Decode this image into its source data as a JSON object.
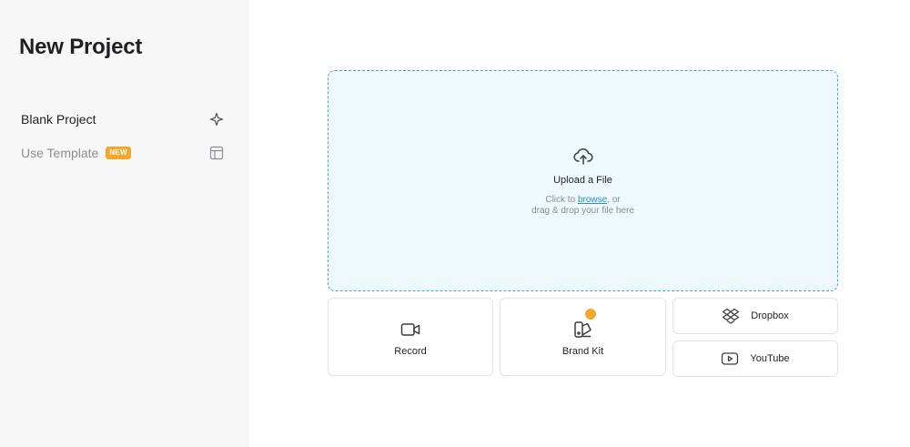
{
  "sidebar": {
    "title": "New Project",
    "items": [
      {
        "label": "Blank Project",
        "icon": "sparkle-icon"
      },
      {
        "label": "Use Template",
        "badge": "NEW",
        "icon": "layout-icon"
      }
    ]
  },
  "upload": {
    "title": "Upload a File",
    "hint_prefix": "Click to",
    "browse_label": "browse",
    "hint_suffix": ", or",
    "hint_line2": "drag & drop your file here",
    "icon": "cloud-upload-icon"
  },
  "sources": [
    {
      "label": "Record",
      "icon": "video-camera-icon"
    },
    {
      "label": "Brand Kit",
      "icon": "brand-kit-icon",
      "crown_icon": "crown-icon"
    },
    {
      "label": "Dropbox",
      "icon": "dropbox-icon"
    },
    {
      "label": "YouTube",
      "icon": "youtube-icon"
    }
  ],
  "colors": {
    "accent": "#2a8fd1",
    "dropzone_bg": "#eff8fd",
    "dropzone_border": "#3da4dc",
    "badge": "#f6a72a",
    "sidebar_bg": "#f7f7f7"
  }
}
